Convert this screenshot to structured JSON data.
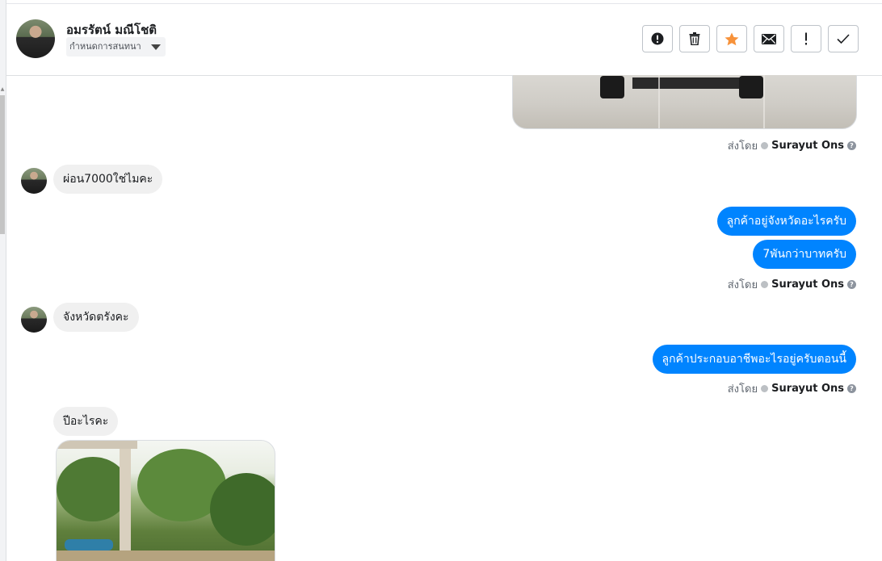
{
  "contact": {
    "name": "อมรรัตน์ มณีโชติ",
    "set_conversation_label": "กำหนดการสนทนา"
  },
  "actions": {
    "icons": [
      "alert-circle-icon",
      "trash-icon",
      "star-icon",
      "envelope-icon",
      "exclamation-icon",
      "check-icon"
    ],
    "star_color": "#f7923a"
  },
  "thread": {
    "sent_by_label": "ส่งโดย",
    "agent_name": "Surayut Ons",
    "messages": {
      "in_1": "ผ่อน7000ใช่ไมคะ",
      "out_1": "ลูกค้าอยู่จังหวัดอะไรครับ",
      "out_2": "7พันกว่าบาทครับ",
      "in_2": "จังหวัดตรังคะ",
      "out_3": "ลูกค้าประกอบอาชีพอะไรอยู่ครับตอนนี้",
      "in_3": "ปีอะไรคะ"
    }
  },
  "colors": {
    "outgoing_bubble": "#0084ff",
    "incoming_bubble": "#f0f0f0"
  }
}
